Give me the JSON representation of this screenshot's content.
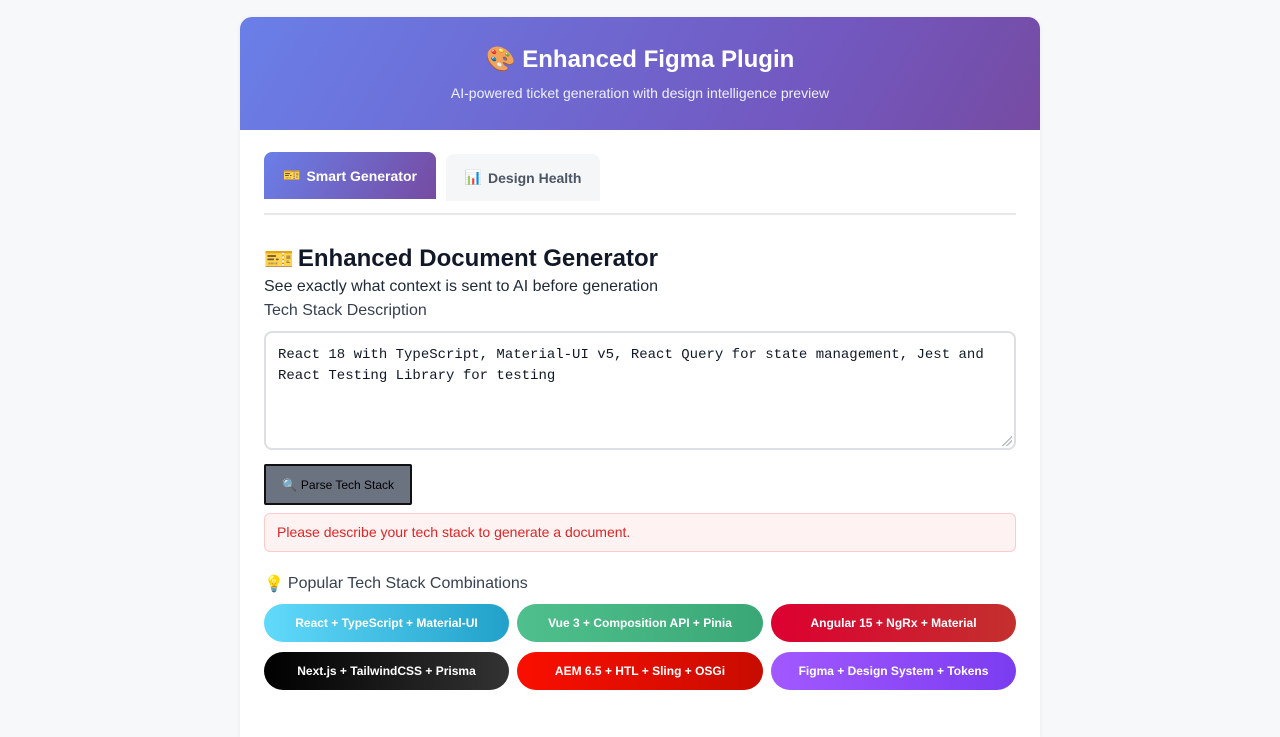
{
  "header": {
    "icon": "🎨",
    "title": "Enhanced Figma Plugin",
    "subtitle": "AI-powered ticket generation with design intelligence preview"
  },
  "tabs": [
    {
      "icon": "🎫",
      "label": "Smart Generator",
      "active": true
    },
    {
      "icon": "📊",
      "label": "Design Health",
      "active": false
    }
  ],
  "generator": {
    "icon": "🎫",
    "title": "Enhanced Document Generator",
    "subtitle": "See exactly what context is sent to AI before generation",
    "field_label": "Tech Stack Description",
    "tech_stack_value": "React 18 with TypeScript, Material-UI v5, React Query for state management, Jest and React Testing Library for testing",
    "parse_button": {
      "icon": "🔍",
      "label": "Parse Tech Stack"
    },
    "alert_text": "Please describe your tech stack to generate a document."
  },
  "popular": {
    "icon": "💡",
    "title": "Popular Tech Stack Combinations",
    "items": [
      "React + TypeScript + Material-UI",
      "Vue 3 + Composition API + Pinia",
      "Angular 15 + NgRx + Material",
      "Next.js + TailwindCSS + Prisma",
      "AEM 6.5 + HTL + Sling + OSGi",
      "Figma + Design System + Tokens"
    ]
  },
  "colors": {
    "accent_start": "#667eea",
    "accent_end": "#764ba2",
    "alert_text": "#dc2626"
  }
}
